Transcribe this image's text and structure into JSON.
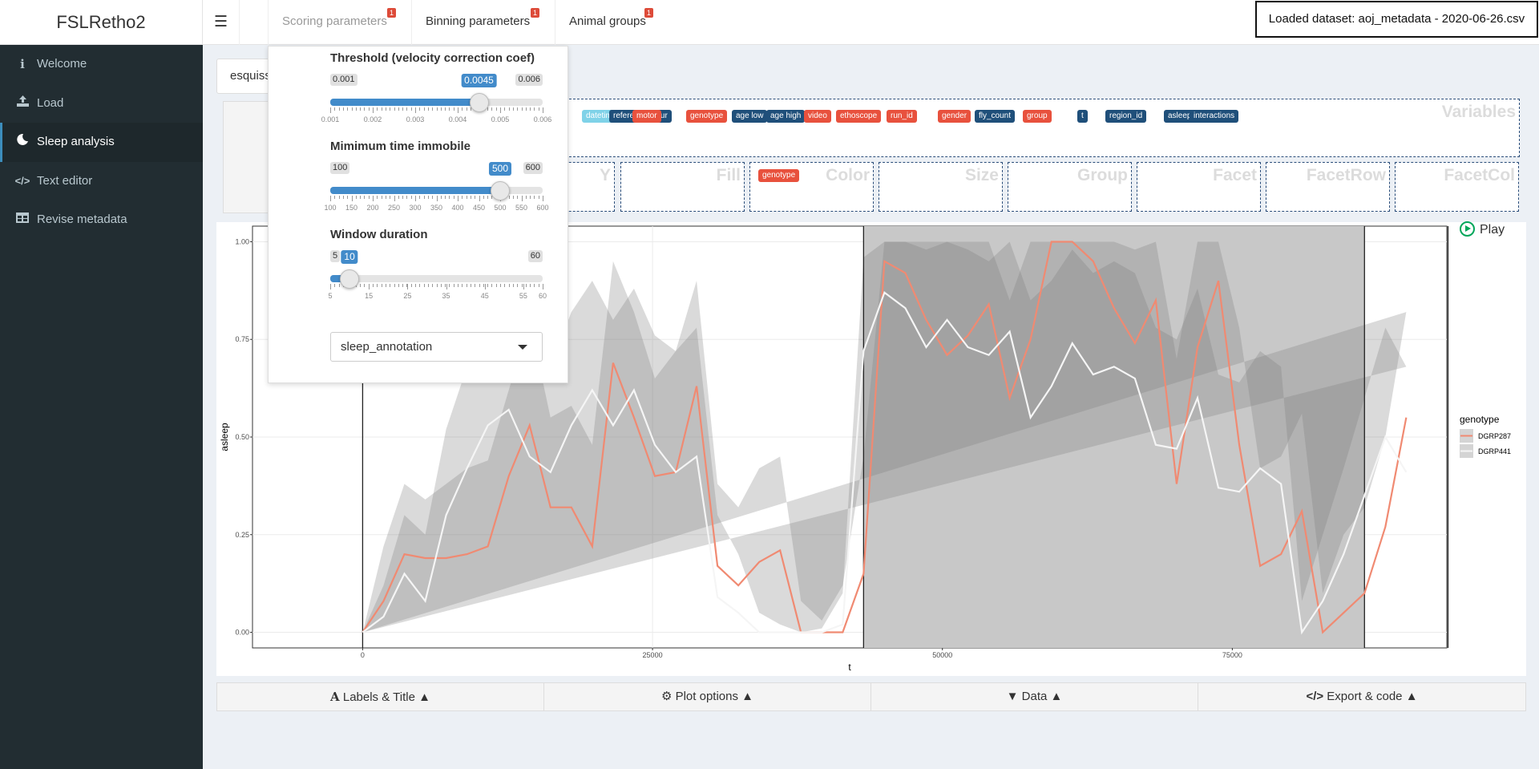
{
  "header": {
    "brand": "FSLRetho2",
    "menu_icon": "hamburger-icon",
    "tabs": [
      {
        "label": "Scoring parameters",
        "badge": "1",
        "dim": true
      },
      {
        "label": "Binning parameters",
        "badge": "1",
        "dim": false
      },
      {
        "label": "Animal groups",
        "badge": "1",
        "dim": false
      }
    ],
    "dataset": "Loaded dataset: aoj_metadata - 2020-06-26.csv"
  },
  "sidebar": {
    "items": [
      {
        "label": "Welcome",
        "icon": "info-icon"
      },
      {
        "label": "Load",
        "icon": "upload-icon"
      },
      {
        "label": "Sleep analysis",
        "icon": "moon-icon",
        "active": true
      },
      {
        "label": "Text editor",
        "icon": "code-icon"
      },
      {
        "label": "Revise metadata",
        "icon": "table-icon"
      }
    ]
  },
  "main": {
    "tab_input": "esquiss",
    "variables": {
      "title": "Variables",
      "chips": [
        {
          "label": "datetime",
          "color": "#7fd2e8"
        },
        {
          "label": "reference_hour",
          "color": "#1f4f7a"
        },
        {
          "label": "motor",
          "color": "#e8513d"
        },
        {
          "label": "genotype",
          "color": "#e8513d"
        },
        {
          "label": "age low",
          "color": "#1f4f7a"
        },
        {
          "label": "age high",
          "color": "#1f4f7a"
        },
        {
          "label": "video",
          "color": "#e8513d"
        },
        {
          "label": "ethoscope",
          "color": "#e8513d"
        },
        {
          "label": "run_id",
          "color": "#e8513d"
        },
        {
          "label": "gender",
          "color": "#e8513d"
        },
        {
          "label": "fly_count",
          "color": "#1f4f7a"
        },
        {
          "label": "group",
          "color": "#e8513d"
        },
        {
          "label": "t",
          "color": "#1f4f7a"
        },
        {
          "label": "region_id",
          "color": "#1f4f7a"
        },
        {
          "label": "asleep",
          "color": "#1f4f7a"
        },
        {
          "label": "interactions",
          "color": "#1f4f7a"
        }
      ]
    },
    "dropzones": [
      {
        "label": "Y",
        "chip": ""
      },
      {
        "label": "Fill",
        "chip": ""
      },
      {
        "label": "Color",
        "chip": "genotype"
      },
      {
        "label": "Size",
        "chip": ""
      },
      {
        "label": "Group",
        "chip": ""
      },
      {
        "label": "Facet",
        "chip": ""
      },
      {
        "label": "FacetRow",
        "chip": ""
      },
      {
        "label": "FacetCol",
        "chip": ""
      }
    ],
    "play": "Play",
    "bottom_buttons": [
      {
        "label": "Labels & Title",
        "icon": "font-icon"
      },
      {
        "label": "Plot options",
        "icon": "gears-icon"
      },
      {
        "label": "Data",
        "icon": "filter-icon"
      },
      {
        "label": "Export & code",
        "icon": "code-icon"
      }
    ]
  },
  "popup": {
    "sliders": [
      {
        "title": "Threshold (velocity correction coef)",
        "min": "0.001",
        "max": "0.006",
        "value": "0.0045",
        "fraction": 0.7,
        "ticks": [
          "0.001",
          "0.002",
          "0.003",
          "0.004",
          "0.005",
          "0.006"
        ]
      },
      {
        "title": "Mimimum time immobile",
        "min": "100",
        "max": "600",
        "value": "500",
        "fraction": 0.8,
        "ticks": [
          "100",
          "150",
          "200",
          "250",
          "300",
          "350",
          "400",
          "450",
          "500",
          "550",
          "600"
        ]
      },
      {
        "title": "Window duration",
        "min": "5",
        "max": "60",
        "value": "10",
        "fraction": 0.0909,
        "ticks": [
          "5",
          "15",
          "25",
          "35",
          "45",
          "55",
          "60"
        ]
      }
    ],
    "select_value": "sleep_annotation"
  },
  "chart_data": {
    "type": "line",
    "xlabel": "t",
    "ylabel": "asleep",
    "xlim": [
      -9500,
      93500
    ],
    "ylim": [
      -0.04,
      1.04
    ],
    "xticks": [
      0,
      25000,
      50000,
      75000
    ],
    "xtick_labels": [
      "0",
      "25000",
      "50000",
      "75000"
    ],
    "yticks": [
      0,
      0.25,
      0.5,
      0.75,
      1
    ],
    "ytick_labels": [
      "0.00",
      "0.25",
      "0.50",
      "0.75",
      "1.00"
    ],
    "dark_period": [
      43200,
      86400
    ],
    "vlines": [
      0,
      43200,
      86400,
      93600
    ],
    "legend_title": "genotype",
    "legend_position": "right",
    "x": [
      0,
      1800,
      3600,
      5400,
      7200,
      9000,
      10800,
      12600,
      14400,
      16200,
      18000,
      19800,
      21600,
      23400,
      25200,
      27000,
      28800,
      30600,
      32400,
      34200,
      36000,
      37800,
      39600,
      41400,
      43200,
      45000,
      46800,
      48600,
      50400,
      52200,
      54000,
      55800,
      57600,
      59400,
      61200,
      63000,
      64800,
      66600,
      68400,
      70200,
      72000,
      73800,
      75600,
      77400,
      79200,
      81000,
      82800,
      84600,
      86400,
      88200,
      90000,
      91800,
      93600
    ],
    "series": [
      {
        "name": "DGRP287",
        "color": "#f08a72",
        "values": [
          0,
          0.08,
          0.2,
          0.19,
          0.19,
          0.2,
          0.22,
          0.4,
          0.53,
          0.32,
          0.32,
          0.22,
          0.69,
          0.55,
          0.4,
          0.41,
          0.63,
          0.17,
          0.12,
          0.18,
          0.21,
          0.0,
          0.0,
          0.0,
          0.15,
          0.95,
          0.92,
          0.8,
          0.71,
          0.76,
          0.84,
          0.6,
          0.75,
          1.0,
          1.0,
          0.95,
          0.83,
          0.74,
          0.85,
          0.38,
          0.73,
          0.9,
          0.48,
          0.17,
          0.2,
          0.31,
          0.0,
          0.05,
          0.1,
          0.27,
          0.55
        ]
      },
      {
        "name": "DGRP441",
        "color": "#f5f5f5",
        "values": [
          0,
          0.04,
          0.15,
          0.08,
          0.3,
          0.42,
          0.53,
          0.57,
          0.45,
          0.41,
          0.53,
          0.62,
          0.53,
          0.62,
          0.48,
          0.41,
          0.45,
          0.09,
          0.05,
          0.0,
          0.0,
          0.0,
          0.0,
          0.02,
          0.72,
          0.87,
          0.83,
          0.73,
          0.8,
          0.73,
          0.71,
          0.77,
          0.55,
          0.63,
          0.74,
          0.66,
          0.68,
          0.65,
          0.48,
          0.47,
          0.6,
          0.37,
          0.36,
          0.42,
          0.38,
          0.0,
          0.08,
          0.2,
          0.35,
          0.5,
          0.41
        ]
      }
    ],
    "ribbons": [
      {
        "lower": [
          0,
          0,
          0,
          0.05,
          0.02,
          0.03,
          0.1,
          0.2,
          0.25,
          0.12,
          0.1,
          0.02,
          0.35,
          0.32,
          0.22,
          0.1,
          0.34,
          0.02,
          0,
          0,
          0,
          0,
          0,
          0,
          0,
          0.55,
          0.6,
          0.5,
          0.43,
          0.5,
          0.58,
          0.4,
          0.48,
          0.75,
          0.72,
          0.7,
          0.58,
          0.5,
          0.55,
          0.1,
          0.45,
          0.65,
          0.2,
          0,
          0,
          0.08,
          0,
          0,
          0,
          0.05,
          0.25
        ],
        "upper": [
          0,
          0.22,
          0.38,
          0.34,
          0.38,
          0.42,
          0.44,
          0.62,
          0.8,
          0.55,
          0.58,
          0.48,
          0.95,
          0.82,
          0.65,
          0.72,
          0.9,
          0.38,
          0.32,
          0.42,
          0.45,
          0.08,
          0.03,
          0.12,
          0.45,
          1,
          1,
          1,
          1,
          1,
          1,
          0.85,
          1,
          1,
          1,
          1,
          1,
          0.98,
          1,
          0.7,
          1,
          1,
          0.78,
          0.42,
          0.45,
          0.56,
          0.1,
          0.25,
          0.32,
          0.5,
          0.82
        ]
      },
      {
        "lower": [
          0,
          0,
          0.02,
          0.01,
          0.08,
          0.12,
          0.2,
          0.28,
          0.18,
          0.15,
          0.22,
          0.32,
          0.25,
          0.3,
          0.18,
          0.12,
          0.15,
          0,
          0,
          0,
          0,
          0,
          0,
          0,
          0.4,
          0.62,
          0.58,
          0.45,
          0.55,
          0.45,
          0.48,
          0.52,
          0.25,
          0.35,
          0.5,
          0.4,
          0.42,
          0.38,
          0.2,
          0.22,
          0.35,
          0.1,
          0.08,
          0.12,
          0.1,
          0,
          0,
          0.02,
          0.1,
          0.2,
          0.15
        ],
        "upper": [
          0,
          0.12,
          0.3,
          0.25,
          0.52,
          0.68,
          0.82,
          0.84,
          0.75,
          0.68,
          0.82,
          0.9,
          0.8,
          0.88,
          0.76,
          0.72,
          0.78,
          0.3,
          0.2,
          0.05,
          0.02,
          0,
          0.01,
          0.1,
          0.96,
          1,
          1,
          0.98,
          1,
          0.98,
          0.95,
          1,
          0.85,
          0.9,
          0.98,
          0.92,
          0.95,
          0.92,
          0.78,
          0.75,
          0.88,
          0.66,
          0.64,
          0.72,
          0.68,
          0.08,
          0.25,
          0.42,
          0.6,
          0.78,
          0.68
        ]
      }
    ]
  }
}
